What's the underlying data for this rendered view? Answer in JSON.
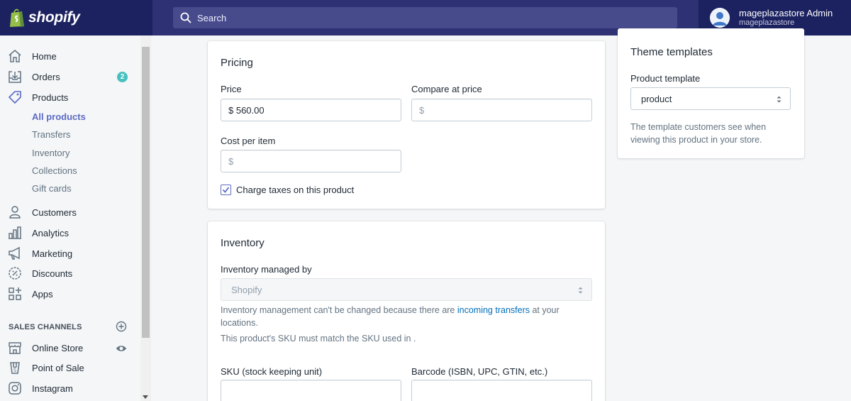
{
  "brand": {
    "logo_text": "shopify",
    "accent": "#5c6ac4",
    "topbar": "#1c2260"
  },
  "search": {
    "placeholder": "Search"
  },
  "user": {
    "name": "mageplazastore Admin",
    "store": "mageplazastore"
  },
  "sidebar": {
    "items": [
      {
        "label": "Home",
        "icon": "home-icon"
      },
      {
        "label": "Orders",
        "icon": "orders-icon",
        "badge": "2"
      },
      {
        "label": "Products",
        "icon": "tag-icon"
      }
    ],
    "product_sub": [
      "All products",
      "Transfers",
      "Inventory",
      "Collections",
      "Gift cards"
    ],
    "items2": [
      {
        "label": "Customers",
        "icon": "person-icon"
      },
      {
        "label": "Analytics",
        "icon": "chart-icon"
      },
      {
        "label": "Marketing",
        "icon": "megaphone-icon"
      },
      {
        "label": "Discounts",
        "icon": "discount-icon"
      },
      {
        "label": "Apps",
        "icon": "apps-icon"
      }
    ],
    "sales_channels_heading": "SALES CHANNELS",
    "channels": [
      {
        "label": "Online Store",
        "icon": "store-icon"
      },
      {
        "label": "Point of Sale",
        "icon": "pos-icon"
      },
      {
        "label": "Instagram",
        "icon": "instagram-icon"
      }
    ]
  },
  "pricing": {
    "title": "Pricing",
    "price_label": "Price",
    "price_value": "$ 560.00",
    "compare_label": "Compare at price",
    "compare_placeholder": "$",
    "cost_label": "Cost per item",
    "cost_placeholder": "$",
    "charge_taxes_label": "Charge taxes on this product",
    "charge_taxes_checked": true
  },
  "inventory": {
    "title": "Inventory",
    "managed_by_label": "Inventory managed by",
    "managed_by_value": "Shopify",
    "help_prefix": "Inventory management can't be changed because there are ",
    "help_link": "incoming transfers",
    "help_suffix": " at your",
    "help_line2": "locations.",
    "sku_note": "This product's SKU must match the SKU used in .",
    "sku_label": "SKU (stock keeping unit)",
    "barcode_label": "Barcode (ISBN, UPC, GTIN, etc.)"
  },
  "theme": {
    "title": "Theme templates",
    "template_label": "Product template",
    "template_value": "product",
    "help_line1": "The template customers see when",
    "help_line2": "viewing this product in your store."
  }
}
